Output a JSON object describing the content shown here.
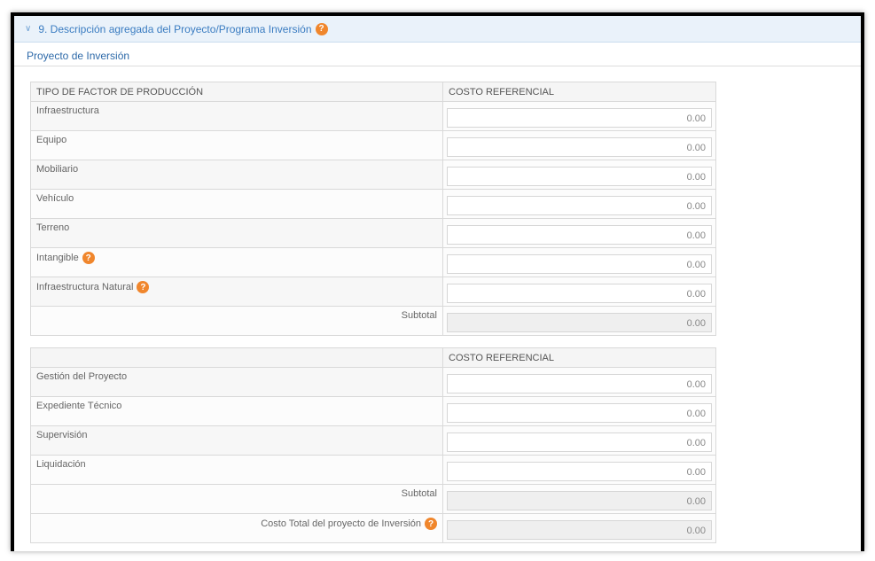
{
  "section": {
    "title": "9. Descripción agregada del Proyecto/Programa Inversión",
    "subtitle": "Proyecto de Inversión",
    "help_glyph": "?"
  },
  "table1": {
    "header_col1": "TIPO DE FACTOR DE PRODUCCIÓN",
    "header_col2": "COSTO REFERENCIAL",
    "rows": [
      {
        "label": "Infraestructura",
        "value": "0.00"
      },
      {
        "label": "Equipo",
        "value": "0.00"
      },
      {
        "label": "Mobiliario",
        "value": "0.00"
      },
      {
        "label": "Vehículo",
        "value": "0.00"
      },
      {
        "label": "Terreno",
        "value": "0.00"
      },
      {
        "label": "Intangible",
        "value": "0.00"
      },
      {
        "label": "Infraestructura Natural",
        "value": "0.00"
      }
    ],
    "subtotal_label": "Subtotal",
    "subtotal_value": "0.00"
  },
  "table2": {
    "header_col1": "",
    "header_col2": "COSTO REFERENCIAL",
    "rows": [
      {
        "label": "Gestión del Proyecto",
        "value": "0.00"
      },
      {
        "label": "Expediente Técnico",
        "value": "0.00"
      },
      {
        "label": "Supervisión",
        "value": "0.00"
      },
      {
        "label": "Liquidación",
        "value": "0.00"
      }
    ],
    "subtotal_label": "Subtotal",
    "subtotal_value": "0.00",
    "total_label": "Costo Total del proyecto de Inversión",
    "total_value": "0.00"
  },
  "colors": {
    "accent": "#3a7cc1",
    "help_badge": "#f0862c",
    "header_bg": "#eaf2fa"
  }
}
